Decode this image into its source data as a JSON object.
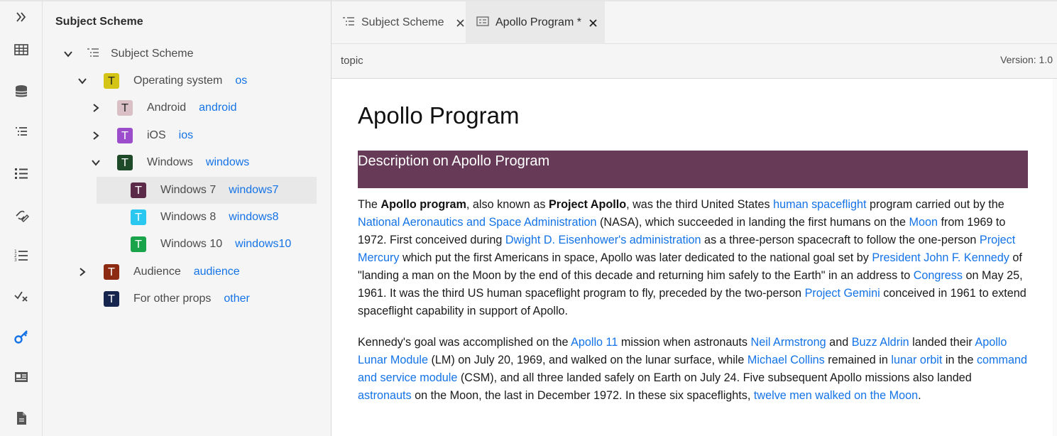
{
  "sidebar_rail": {
    "items": [
      "expand-icon",
      "grid-icon",
      "database-icon",
      "outline-list-icon",
      "bullet-list-icon",
      "link-edit-icon",
      "numbered-list-icon",
      "check-cross-icon",
      "key-icon",
      "id-card-icon",
      "document-icon"
    ]
  },
  "tree": {
    "title": "Subject Scheme",
    "root_label": "Subject Scheme",
    "nodes": [
      {
        "label": "Operating system",
        "key": "os",
        "badge": "T",
        "color": "#d4c415"
      },
      {
        "label": "Android",
        "key": "android",
        "badge": "T",
        "color": "#d9bfc6"
      },
      {
        "label": "iOS",
        "key": "ios",
        "badge": "T",
        "color": "#9b4dcc"
      },
      {
        "label": "Windows",
        "key": "windows",
        "badge": "T",
        "color": "#1f4a2a"
      },
      {
        "label": "Windows 7",
        "key": "windows7",
        "badge": "T",
        "color": "#5b2a49"
      },
      {
        "label": "Windows 8",
        "key": "windows8",
        "badge": "T",
        "color": "#2ac8f0"
      },
      {
        "label": "Windows 10",
        "key": "windows10",
        "badge": "T",
        "color": "#19a34a"
      },
      {
        "label": "Audience",
        "key": "audience",
        "badge": "T",
        "color": "#8c2a12"
      },
      {
        "label": "For other props",
        "key": "other",
        "badge": "T",
        "color": "#16254d"
      }
    ]
  },
  "tabs": [
    {
      "label": "Subject Scheme"
    },
    {
      "label": "Apollo Program *"
    }
  ],
  "infobar": {
    "type": "topic",
    "version": "Version: 1.0"
  },
  "document": {
    "title": "Apollo Program",
    "section_title": "Description on Apollo Program",
    "p1": {
      "t1": "The ",
      "b1": "Apollo program",
      "t2": ", also known as ",
      "b2": "Project Apollo",
      "t3": ", was the third United States ",
      "l1": "human spaceflight",
      "t4": " program carried out by the ",
      "l2": "National Aeronautics and Space Administration",
      "t5": " (NASA), which succeeded in landing the first humans on the ",
      "l3": "Moon",
      "t6": " from 1969 to 1972. First conceived during ",
      "l4": "Dwight D. Eisenhower's administration",
      "t7": " as a three-person spacecraft to follow the one-person ",
      "l5": "Project Mercury",
      "t8": " which put the first Americans in space, Apollo was later dedicated to the national goal set by ",
      "l6": "President John F. Kennedy",
      "t9": " of \"landing a man on the Moon by the end of this decade and returning him safely to the Earth\" in an address to ",
      "l7": "Congress",
      "t10": " on May 25, 1961. It was the third US human spaceflight program to fly, preceded by the two-person ",
      "l8": "Project Gemini",
      "t11": " conceived in 1961 to extend spaceflight capability in support of Apollo."
    },
    "p2": {
      "t1": "Kennedy's goal was accomplished on the ",
      "l1": "Apollo 11",
      "t2": " mission when astronauts ",
      "l2": "Neil Armstrong",
      "t3": " and ",
      "l3": "Buzz Aldrin",
      "t4": " landed their ",
      "l4": "Apollo Lunar Module",
      "t5": " (LM) on July 20, 1969, and walked on the lunar surface, while ",
      "l5": "Michael Collins",
      "t6": " remained in ",
      "l6": "lunar orbit",
      "t7": " in the ",
      "l7": "command and service module",
      "t8": " (CSM), and all three landed safely on Earth on July 24. Five subsequent Apollo missions also landed ",
      "l8": "astronauts",
      "t9": " on the Moon, the last in December 1972. In these six spaceflights, ",
      "l9": "twelve men walked on the Moon",
      "t10": "."
    }
  },
  "colors": {
    "link": "#1473e6",
    "section_bg": "#673b58",
    "active_rail_icon": "#1473e6"
  }
}
